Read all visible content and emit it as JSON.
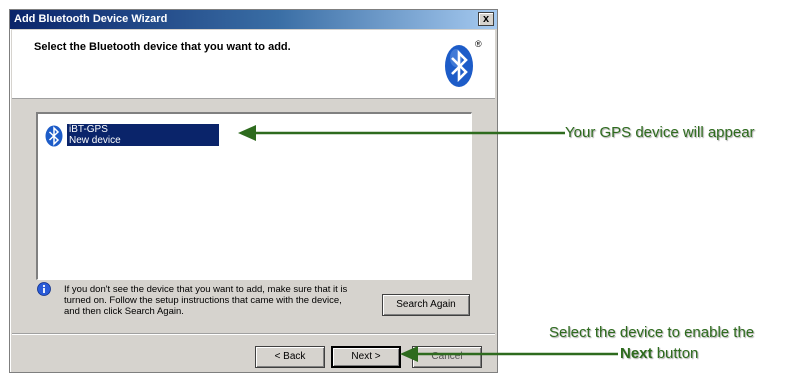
{
  "window": {
    "title": "Add Bluetooth Device Wizard",
    "close_label": "x"
  },
  "header": {
    "title": "Select the Bluetooth device that you want to add.",
    "logo": "bluetooth-logo",
    "reg_mark": "®"
  },
  "device_list": {
    "items": [
      {
        "name": "iBT-GPS",
        "status": "New device",
        "icon": "bluetooth-icon",
        "selected": true
      }
    ]
  },
  "info": {
    "icon": "info-icon",
    "line1": "If you don't see the device that you want to add, make sure that it is",
    "line2": "turned on. Follow the setup instructions that came with the device,",
    "line3": "and then click Search Again."
  },
  "buttons": {
    "search_again": "Search Again",
    "back": "< Back",
    "next": "Next >",
    "cancel": "Cancel"
  },
  "annotations": {
    "device_appear": "Your GPS device will appear",
    "select_line1": "Select the device to enable the",
    "select_line2_bold": "Next",
    "select_line2_rest": "button",
    "color": "#2e6b1e"
  },
  "colors": {
    "title_bar": "#0a246a",
    "selection": "#0a246a",
    "dialog_face": "#d6d3ce",
    "annotation": "#2e6b1e"
  }
}
